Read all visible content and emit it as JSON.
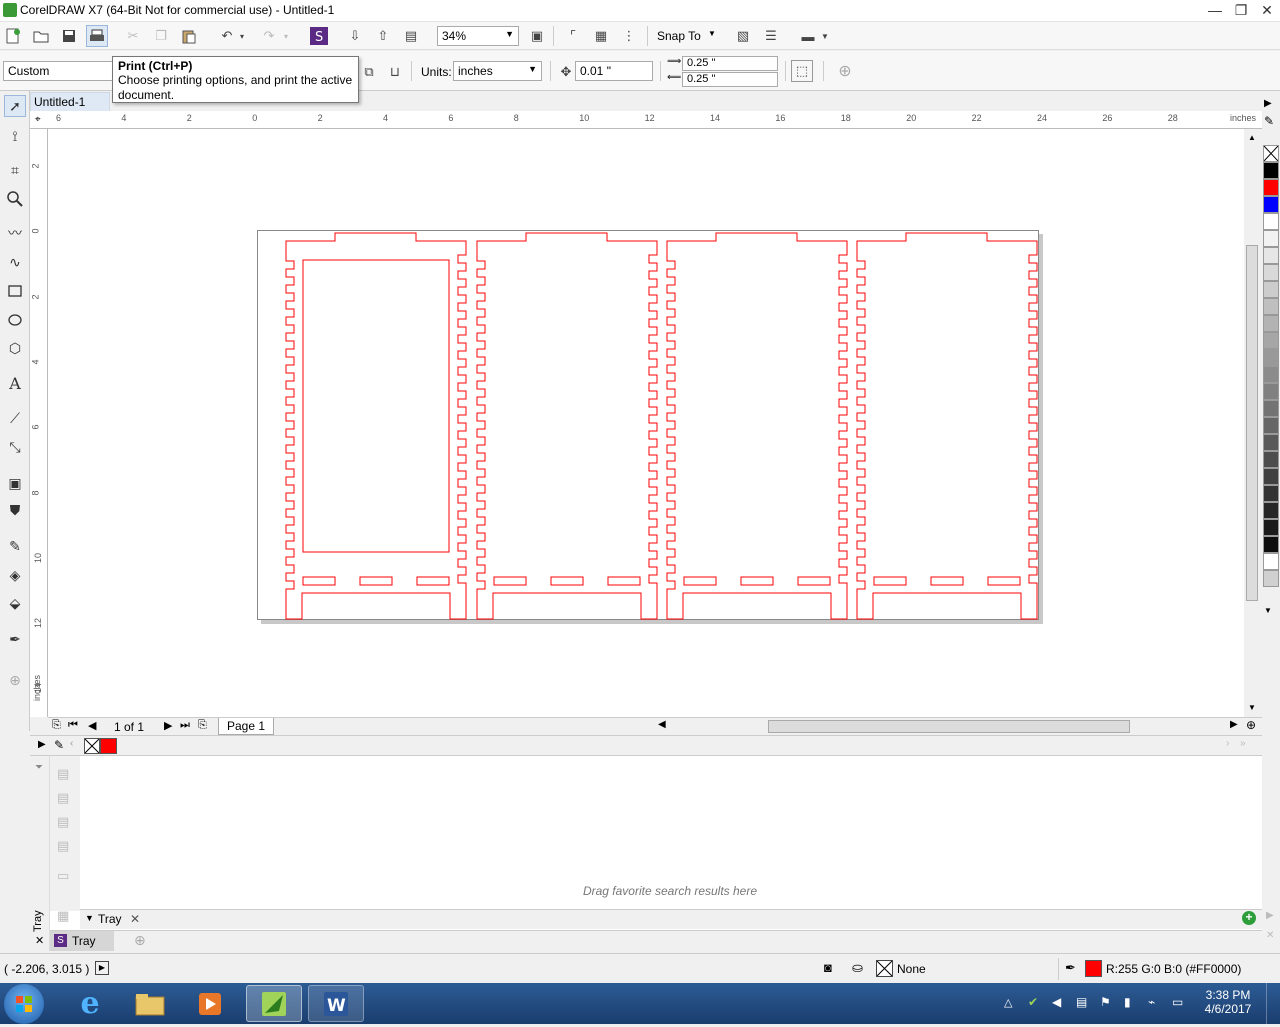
{
  "window": {
    "title": "CorelDRAW X7 (64-Bit Not for commercial use) - Untitled-1",
    "min": "—",
    "max": "❐",
    "close": "✕"
  },
  "toolbar": {
    "zoom": "34%",
    "snap_to": "Snap To"
  },
  "propertybar": {
    "paper_preset": "Custom",
    "units_label": "Units:",
    "units_value": "inches",
    "nudge": "0.01 \"",
    "dup_x": "0.25 \"",
    "dup_y": "0.25 \""
  },
  "tooltip": {
    "title": "Print (Ctrl+P)",
    "description": "Choose printing options, and print the active document."
  },
  "document_tab": "Untitled-1",
  "ruler": {
    "h_labels": [
      "6",
      "4",
      "2",
      "0",
      "2",
      "4",
      "6",
      "8",
      "10",
      "12",
      "14",
      "16",
      "18",
      "20",
      "22",
      "24",
      "26",
      "28"
    ],
    "h_unit": "inches",
    "v_labels": [
      "2",
      "0",
      "2",
      "4",
      "6",
      "8",
      "10",
      "12",
      "14"
    ],
    "v_unit": "inches"
  },
  "page_nav": {
    "counter": "1 of 1",
    "page_tab": "Page 1"
  },
  "tray": {
    "hint": "Drag favorite search results here",
    "tab_label": "Tray",
    "dock_label": "Tray",
    "side_label": "Tray"
  },
  "status": {
    "coords": "( -2.206, 3.015  )",
    "fill_label": "None",
    "outline_color": "R:255 G:0 B:0 (#FF0000)"
  },
  "clock": {
    "time": "3:38 PM",
    "date": "4/6/2017"
  },
  "colors": {
    "outline": "#ff0000",
    "palette": [
      "#000000",
      "#ff0000",
      "#0000ff",
      "#ffffff",
      "#f2f2f2",
      "#e6e6e6",
      "#d9d9d9",
      "#cccccc",
      "#bfbfbf",
      "#b3b3b3",
      "#a6a6a6",
      "#999999",
      "#8c8c8c",
      "#808080",
      "#737373",
      "#666666",
      "#595959",
      "#4d4d4d",
      "#404040",
      "#333333",
      "#262626",
      "#1a1a1a",
      "#0d0d0d",
      "#ffffff",
      "#d0d0d0"
    ]
  }
}
